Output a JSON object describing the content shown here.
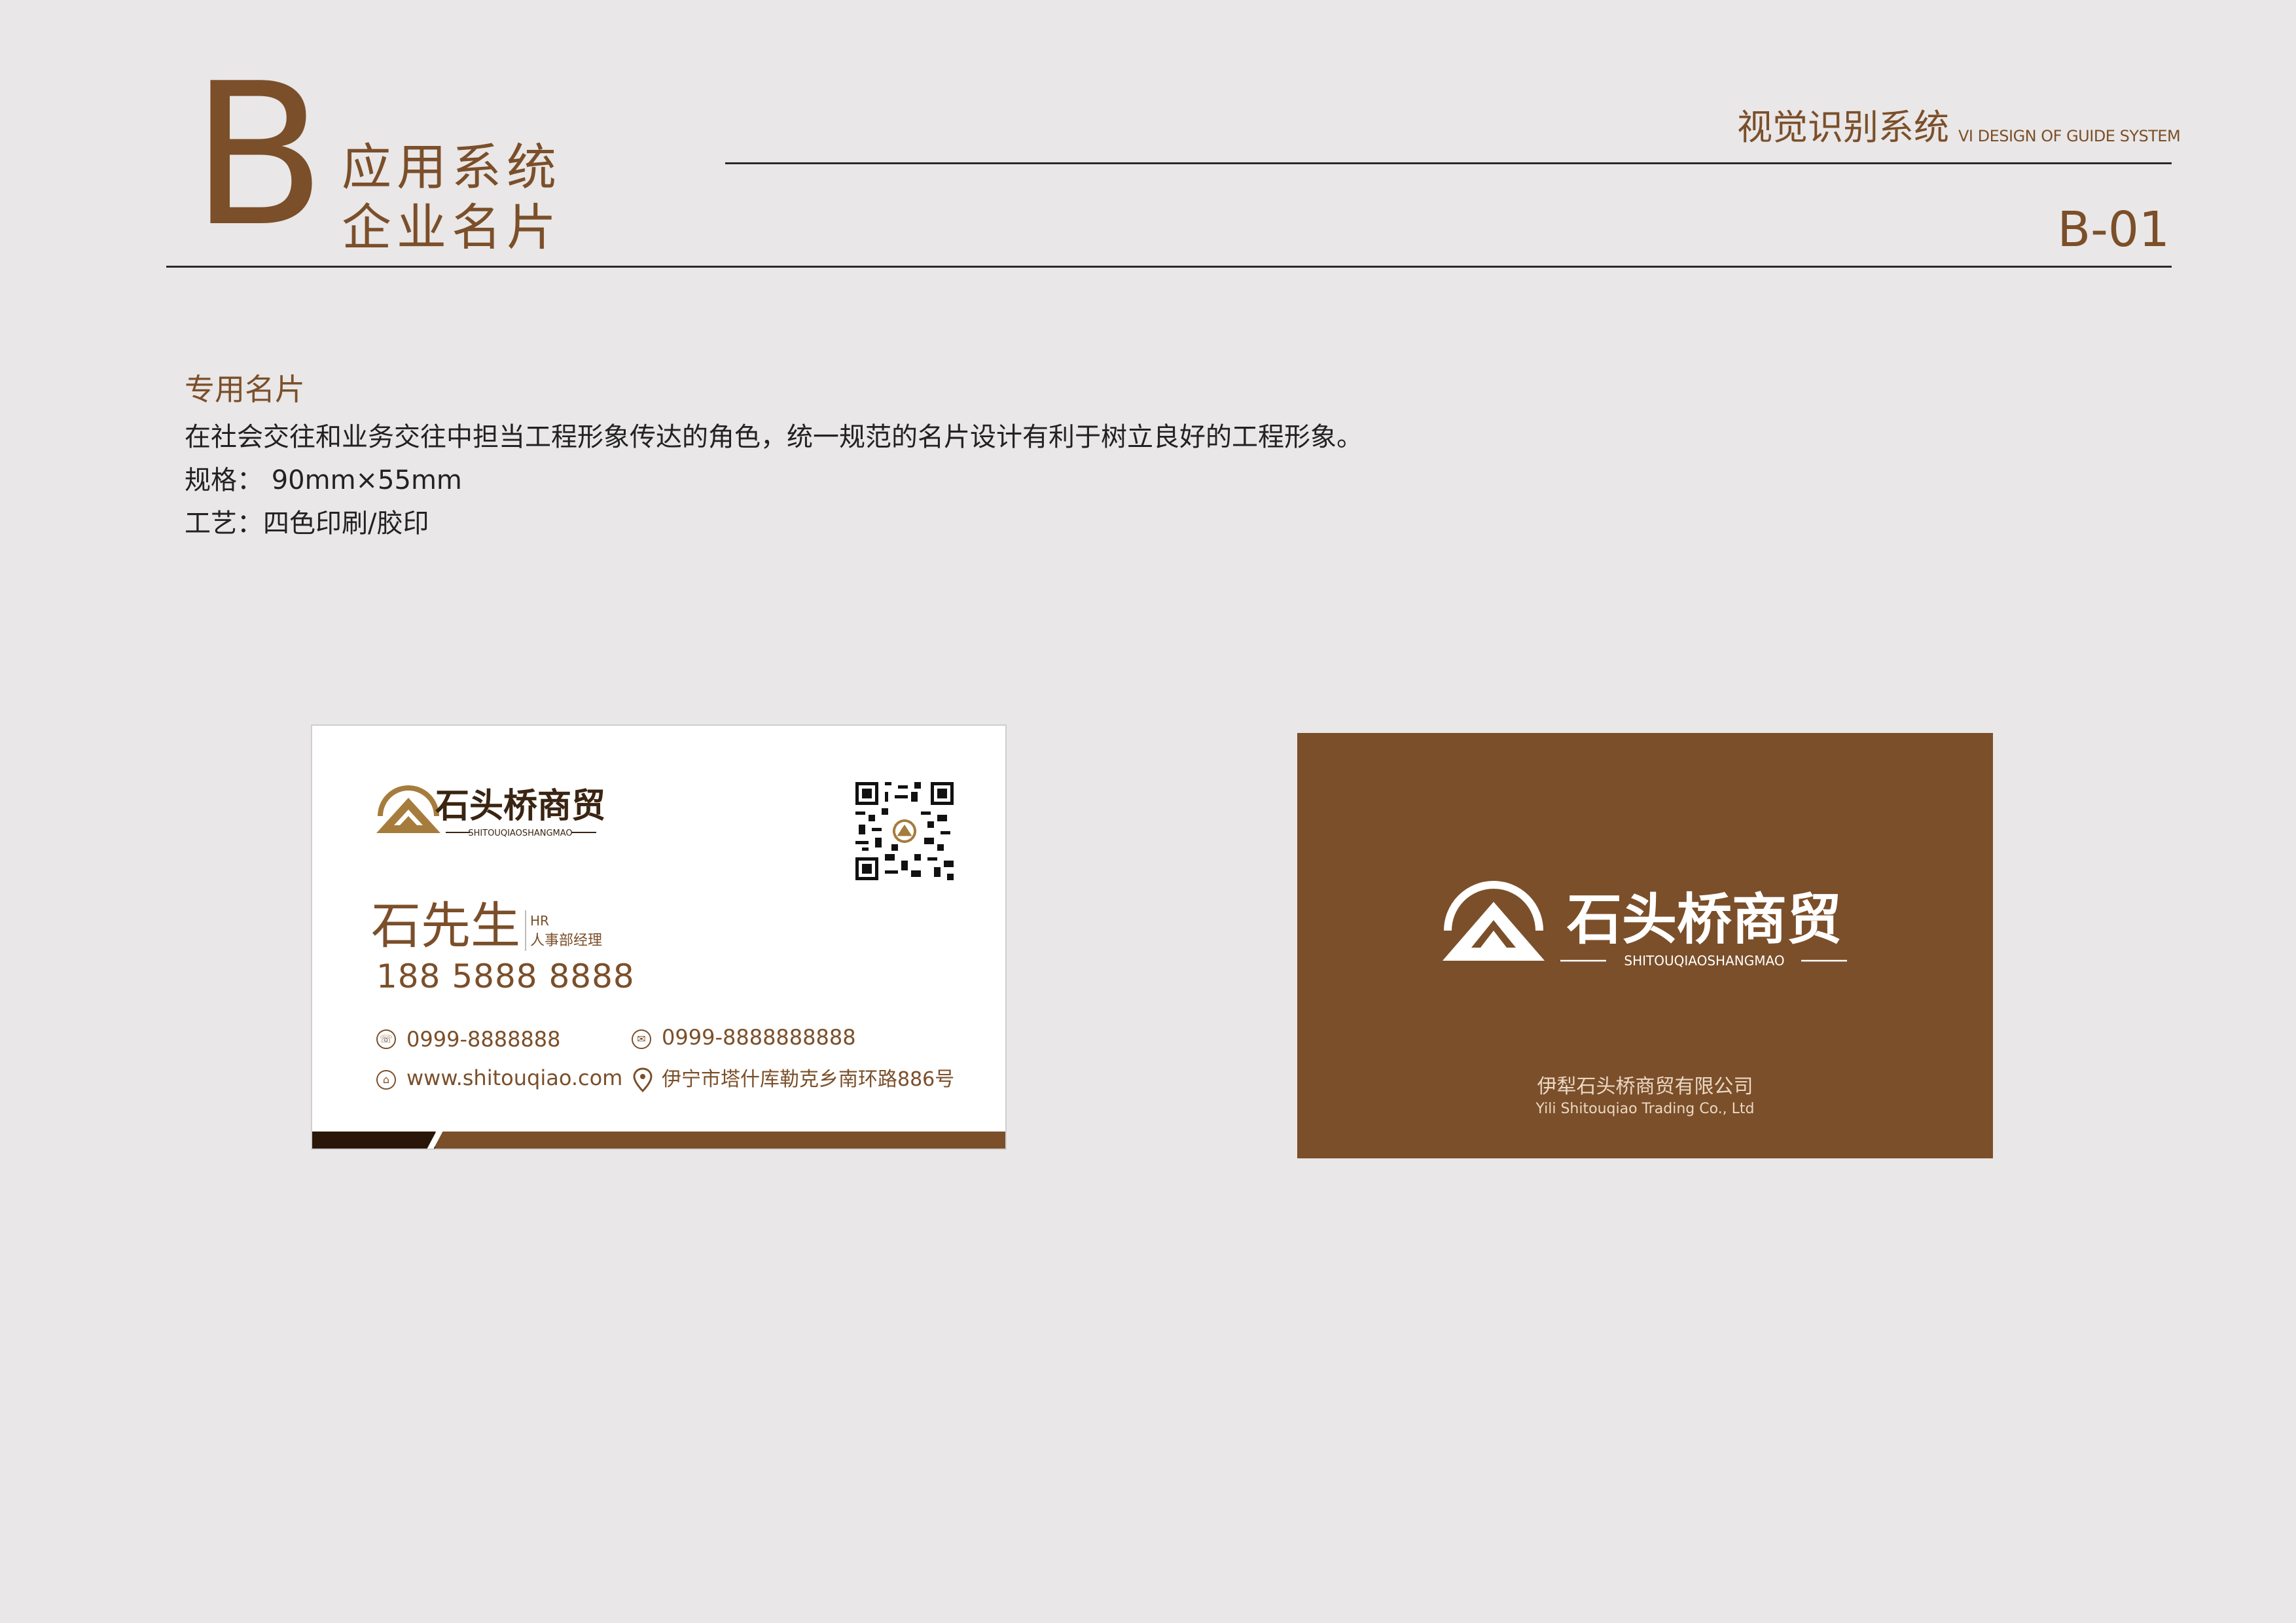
{
  "header": {
    "section_letter": "B",
    "section_line1": "应用系统",
    "section_line2": "企业名片",
    "vi_cn": "视觉识别系统",
    "vi_en": "VI DESIGN OF GUIDE SYSTEM",
    "page_number": "B-01"
  },
  "description": {
    "title": "专用名片",
    "line1": "在社会交往和业务交往中担当工程形象传达的角色，统一规范的名片设计有利于树立良好的工程形象。",
    "line2": "规格： 90mm×55mm",
    "line3": "工艺：四色印刷/胶印"
  },
  "front_card": {
    "brand_cn": "石头桥商贸",
    "brand_en": "SHITOUQIAOSHANGMAO",
    "name": "石先生",
    "title_en": "HR",
    "title_cn": "人事部经理",
    "mobile": "188 5888 8888",
    "phone": "0999-8888888",
    "fax": "0999-8888888888",
    "website": "www.shitouqiao.com",
    "address": "伊宁市塔什库勒克乡南环路886号",
    "icons": [
      "phone-icon",
      "fax-icon",
      "web-icon",
      "location-icon",
      "qr-code-icon"
    ]
  },
  "back_card": {
    "brand_cn": "石头桥商贸",
    "brand_en": "SHITOUQIAOSHANGMAO",
    "company_cn": "伊犁石头桥商贸有限公司",
    "company_en": "Yili Shitouqiao Trading Co., Ltd"
  },
  "colors": {
    "brand_brown": "#7b4f2a",
    "logo_gold": "#a67c3d",
    "background": "#e9e7e7"
  }
}
